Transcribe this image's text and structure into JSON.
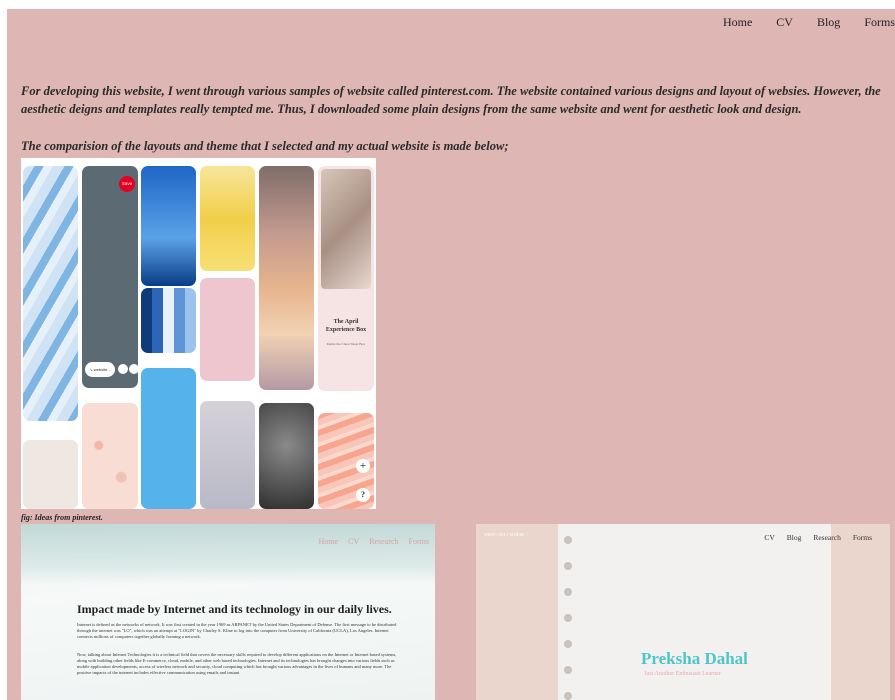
{
  "nav": {
    "items": [
      {
        "label": "Home"
      },
      {
        "label": "CV"
      },
      {
        "label": "Blog"
      },
      {
        "label": "Forms"
      }
    ]
  },
  "intro": {
    "paragraph": "For developing this website, I went through various samples of website called pinterest.com. The website contained various designs and layout of websies. However, the aesthetic deigns and templates really tempted me. Thus, I downloaded some plain designs from the same website and went for aesthetic look and design.",
    "comparison": "The comparision of the layouts and theme that I selected and my actual website is made below;"
  },
  "collage": {
    "save_button": "Save",
    "search_chip": "↘ website...",
    "april_title": "The April Experience Box",
    "april_sub": "Inside the Cheat Sheet Box",
    "plus_glyph": "+",
    "question_glyph": "?",
    "caption": "fig: Ideas from pinterest."
  },
  "screenshot_one": {
    "nav": [
      "Home",
      "CV",
      "Research",
      "Forms"
    ],
    "title": "Impact made by Internet and its technology in our daily lives.",
    "para1": "Internet is defined as the networks of network. It was first created in the year 1969 as ARPANET by the United States Department of Defense. The first message to be distributed through the internet was \"LO\", which was an attempt at \"LOGIN\" by Charley S. Kline to log into the computer from University of California (UCLA), Los Angeles. Internet connects millions of computers together globally forming a network.",
    "para2": "Now, talking about Internet Technologies it is a technical field that covers the necessary skills required to develop different applications on the Internet or Internet based systems, along with building other fields like E-commerce, cloud, mobile, and other web based technologies. Internet and its technologies has brought changes into various fields such as mobile application developments, access of wireless network and security, cloud computing which has brought various advantages in the lives of humans and many more. The positive impacts of the internet includes effective communication using emails and instant"
  },
  "screenshot_two": {
    "tag": "WHAT I SEE I’M HERE ♡",
    "nav": [
      "CV",
      "Blog",
      "Research",
      "Forms"
    ],
    "name": "Preksha Dahal",
    "subtitle": "Just Another Enthusiast Learner"
  },
  "colors": {
    "background": "#deb6b3",
    "accent_teal": "#4ec5c8",
    "accent_pink": "#e6a9b2",
    "pinterest_red": "#e60023"
  }
}
